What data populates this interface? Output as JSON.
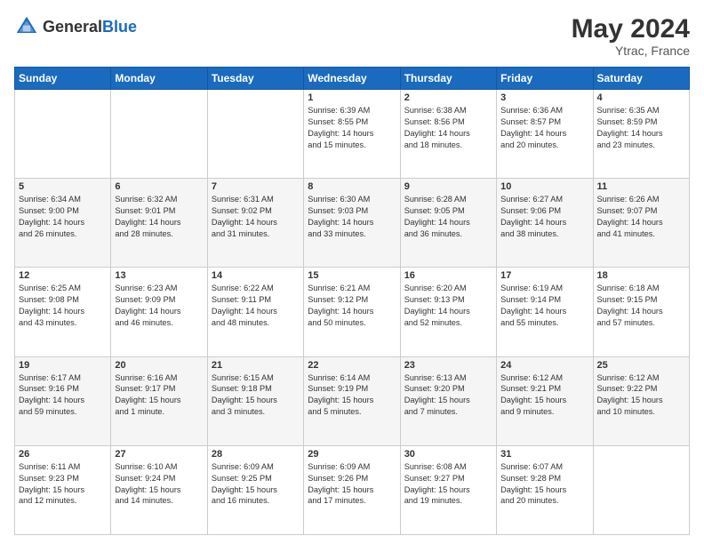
{
  "header": {
    "logo": {
      "general": "General",
      "blue": "Blue"
    },
    "title": "May 2024",
    "location": "Ytrac, France"
  },
  "days_of_week": [
    "Sunday",
    "Monday",
    "Tuesday",
    "Wednesday",
    "Thursday",
    "Friday",
    "Saturday"
  ],
  "weeks": [
    [
      {
        "day": "",
        "info": ""
      },
      {
        "day": "",
        "info": ""
      },
      {
        "day": "",
        "info": ""
      },
      {
        "day": "1",
        "info": "Sunrise: 6:39 AM\nSunset: 8:55 PM\nDaylight: 14 hours\nand 15 minutes."
      },
      {
        "day": "2",
        "info": "Sunrise: 6:38 AM\nSunset: 8:56 PM\nDaylight: 14 hours\nand 18 minutes."
      },
      {
        "day": "3",
        "info": "Sunrise: 6:36 AM\nSunset: 8:57 PM\nDaylight: 14 hours\nand 20 minutes."
      },
      {
        "day": "4",
        "info": "Sunrise: 6:35 AM\nSunset: 8:59 PM\nDaylight: 14 hours\nand 23 minutes."
      }
    ],
    [
      {
        "day": "5",
        "info": "Sunrise: 6:34 AM\nSunset: 9:00 PM\nDaylight: 14 hours\nand 26 minutes."
      },
      {
        "day": "6",
        "info": "Sunrise: 6:32 AM\nSunset: 9:01 PM\nDaylight: 14 hours\nand 28 minutes."
      },
      {
        "day": "7",
        "info": "Sunrise: 6:31 AM\nSunset: 9:02 PM\nDaylight: 14 hours\nand 31 minutes."
      },
      {
        "day": "8",
        "info": "Sunrise: 6:30 AM\nSunset: 9:03 PM\nDaylight: 14 hours\nand 33 minutes."
      },
      {
        "day": "9",
        "info": "Sunrise: 6:28 AM\nSunset: 9:05 PM\nDaylight: 14 hours\nand 36 minutes."
      },
      {
        "day": "10",
        "info": "Sunrise: 6:27 AM\nSunset: 9:06 PM\nDaylight: 14 hours\nand 38 minutes."
      },
      {
        "day": "11",
        "info": "Sunrise: 6:26 AM\nSunset: 9:07 PM\nDaylight: 14 hours\nand 41 minutes."
      }
    ],
    [
      {
        "day": "12",
        "info": "Sunrise: 6:25 AM\nSunset: 9:08 PM\nDaylight: 14 hours\nand 43 minutes."
      },
      {
        "day": "13",
        "info": "Sunrise: 6:23 AM\nSunset: 9:09 PM\nDaylight: 14 hours\nand 46 minutes."
      },
      {
        "day": "14",
        "info": "Sunrise: 6:22 AM\nSunset: 9:11 PM\nDaylight: 14 hours\nand 48 minutes."
      },
      {
        "day": "15",
        "info": "Sunrise: 6:21 AM\nSunset: 9:12 PM\nDaylight: 14 hours\nand 50 minutes."
      },
      {
        "day": "16",
        "info": "Sunrise: 6:20 AM\nSunset: 9:13 PM\nDaylight: 14 hours\nand 52 minutes."
      },
      {
        "day": "17",
        "info": "Sunrise: 6:19 AM\nSunset: 9:14 PM\nDaylight: 14 hours\nand 55 minutes."
      },
      {
        "day": "18",
        "info": "Sunrise: 6:18 AM\nSunset: 9:15 PM\nDaylight: 14 hours\nand 57 minutes."
      }
    ],
    [
      {
        "day": "19",
        "info": "Sunrise: 6:17 AM\nSunset: 9:16 PM\nDaylight: 14 hours\nand 59 minutes."
      },
      {
        "day": "20",
        "info": "Sunrise: 6:16 AM\nSunset: 9:17 PM\nDaylight: 15 hours\nand 1 minute."
      },
      {
        "day": "21",
        "info": "Sunrise: 6:15 AM\nSunset: 9:18 PM\nDaylight: 15 hours\nand 3 minutes."
      },
      {
        "day": "22",
        "info": "Sunrise: 6:14 AM\nSunset: 9:19 PM\nDaylight: 15 hours\nand 5 minutes."
      },
      {
        "day": "23",
        "info": "Sunrise: 6:13 AM\nSunset: 9:20 PM\nDaylight: 15 hours\nand 7 minutes."
      },
      {
        "day": "24",
        "info": "Sunrise: 6:12 AM\nSunset: 9:21 PM\nDaylight: 15 hours\nand 9 minutes."
      },
      {
        "day": "25",
        "info": "Sunrise: 6:12 AM\nSunset: 9:22 PM\nDaylight: 15 hours\nand 10 minutes."
      }
    ],
    [
      {
        "day": "26",
        "info": "Sunrise: 6:11 AM\nSunset: 9:23 PM\nDaylight: 15 hours\nand 12 minutes."
      },
      {
        "day": "27",
        "info": "Sunrise: 6:10 AM\nSunset: 9:24 PM\nDaylight: 15 hours\nand 14 minutes."
      },
      {
        "day": "28",
        "info": "Sunrise: 6:09 AM\nSunset: 9:25 PM\nDaylight: 15 hours\nand 16 minutes."
      },
      {
        "day": "29",
        "info": "Sunrise: 6:09 AM\nSunset: 9:26 PM\nDaylight: 15 hours\nand 17 minutes."
      },
      {
        "day": "30",
        "info": "Sunrise: 6:08 AM\nSunset: 9:27 PM\nDaylight: 15 hours\nand 19 minutes."
      },
      {
        "day": "31",
        "info": "Sunrise: 6:07 AM\nSunset: 9:28 PM\nDaylight: 15 hours\nand 20 minutes."
      },
      {
        "day": "",
        "info": ""
      }
    ]
  ]
}
